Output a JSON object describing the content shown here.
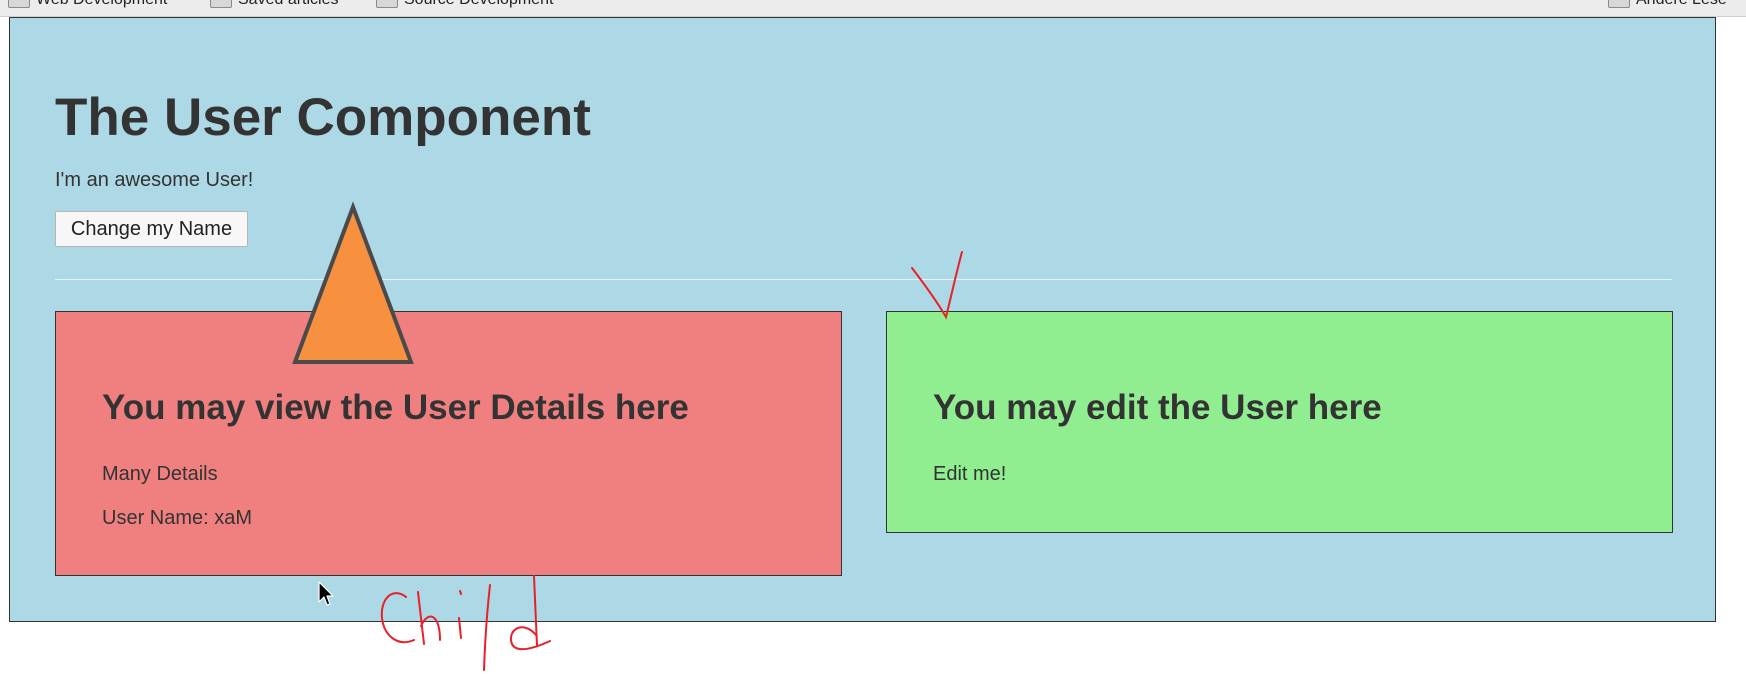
{
  "bookmarks": {
    "items": [
      "Web Development",
      "Saved articles",
      "Source Development"
    ],
    "right_item": "Andere Lese"
  },
  "app": {
    "title": "The User Component",
    "subtitle": "I'm an awesome User!",
    "change_name_button": "Change my Name"
  },
  "user_detail": {
    "title": "You may view the User Details here",
    "text": "Many Details",
    "user_name": "User Name: xaM"
  },
  "user_edit": {
    "title": "You may edit the User here",
    "text": "Edit me!"
  },
  "annotations": {
    "handwriting": "Child"
  },
  "colors": {
    "parent_bg": "#add8e6",
    "detail_bg": "#f08080",
    "edit_bg": "#90ee90",
    "arrow_fill": "#f7913f",
    "ink": "#e8202a"
  },
  "icons": [
    "folder-icon",
    "mouse-cursor-icon",
    "up-arrow-annotation",
    "checkmark-annotation"
  ]
}
